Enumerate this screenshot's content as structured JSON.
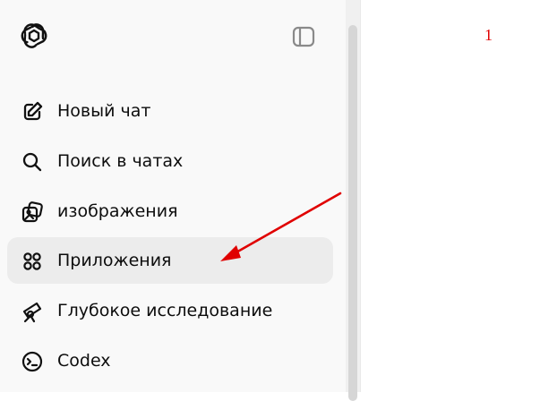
{
  "sidebar": {
    "logo_icon": "openai-logo-icon",
    "toggle_icon": "sidebar-toggle-icon",
    "items": [
      {
        "label": "Новый чат",
        "icon": "pencil-square-icon",
        "active": false
      },
      {
        "label": "Поиск в чатах",
        "icon": "search-icon",
        "active": false
      },
      {
        "label": "изображения",
        "icon": "images-icon",
        "active": false
      },
      {
        "label": "Приложения",
        "icon": "apps-grid-icon",
        "active": true
      },
      {
        "label": "Глубокое исследование",
        "icon": "telescope-icon",
        "active": false
      },
      {
        "label": "Codex",
        "icon": "codex-terminal-icon",
        "active": false
      }
    ]
  },
  "annotation": {
    "number": "1",
    "color": "#e00000"
  }
}
